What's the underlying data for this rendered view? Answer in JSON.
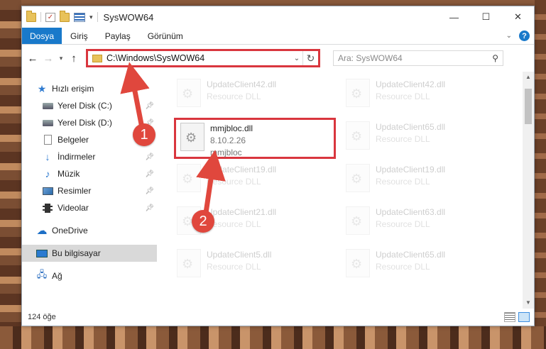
{
  "window": {
    "title": "SysWOW64",
    "minimize": "—",
    "maximize": "☐",
    "close": "✕"
  },
  "ribbon": {
    "tabs": [
      "Dosya",
      "Giriş",
      "Paylaş",
      "Görünüm"
    ],
    "help": "?"
  },
  "address": {
    "path": "C:\\Windows\\SysWOW64",
    "search_placeholder": "Ara: SysWOW64"
  },
  "sidebar": {
    "quick_access": "Hızlı erişim",
    "items": [
      {
        "label": "Yerel Disk (C:)",
        "icon": "drive-icon",
        "pinned": true
      },
      {
        "label": "Yerel Disk (D:)",
        "icon": "drive-icon",
        "pinned": true
      },
      {
        "label": "Belgeler",
        "icon": "document-icon",
        "pinned": true
      },
      {
        "label": "İndirmeler",
        "icon": "download-icon",
        "pinned": true
      },
      {
        "label": "Müzik",
        "icon": "music-icon",
        "pinned": true
      },
      {
        "label": "Resimler",
        "icon": "picture-icon",
        "pinned": true
      },
      {
        "label": "Videolar",
        "icon": "video-icon",
        "pinned": true
      }
    ],
    "onedrive": "OneDrive",
    "this_pc": "Bu bilgisayar",
    "network": "Ağ"
  },
  "files": {
    "highlighted": {
      "name": "mmjbloc.dll",
      "version": "8.10.2.26",
      "description": "mmjbloc"
    },
    "left_column": [
      {
        "name": "UpdateClient42.dll",
        "sub": "Resource DLL"
      },
      {
        "name": "UpdateClient19.dll",
        "sub": "Resource DLL"
      },
      {
        "name": "UpdateClient21.dll",
        "sub": "Resource DLL"
      },
      {
        "name": "UpdateClient5.dll",
        "sub": "Resource DLL"
      }
    ],
    "right_column": [
      {
        "name": "UpdateClient42.dll",
        "sub": "Resource DLL"
      },
      {
        "name": "UpdateClient65.dll",
        "sub": "Resource DLL"
      },
      {
        "name": "UpdateClient19.dll",
        "sub": "Resource DLL"
      },
      {
        "name": "UpdateClient63.dll",
        "sub": "Resource DLL"
      },
      {
        "name": "UpdateClient65.dll",
        "sub": "Resource DLL"
      }
    ]
  },
  "status": {
    "count": "124 öğe"
  },
  "annotations": {
    "step1": "1",
    "step2": "2",
    "color": "#e0473d"
  }
}
